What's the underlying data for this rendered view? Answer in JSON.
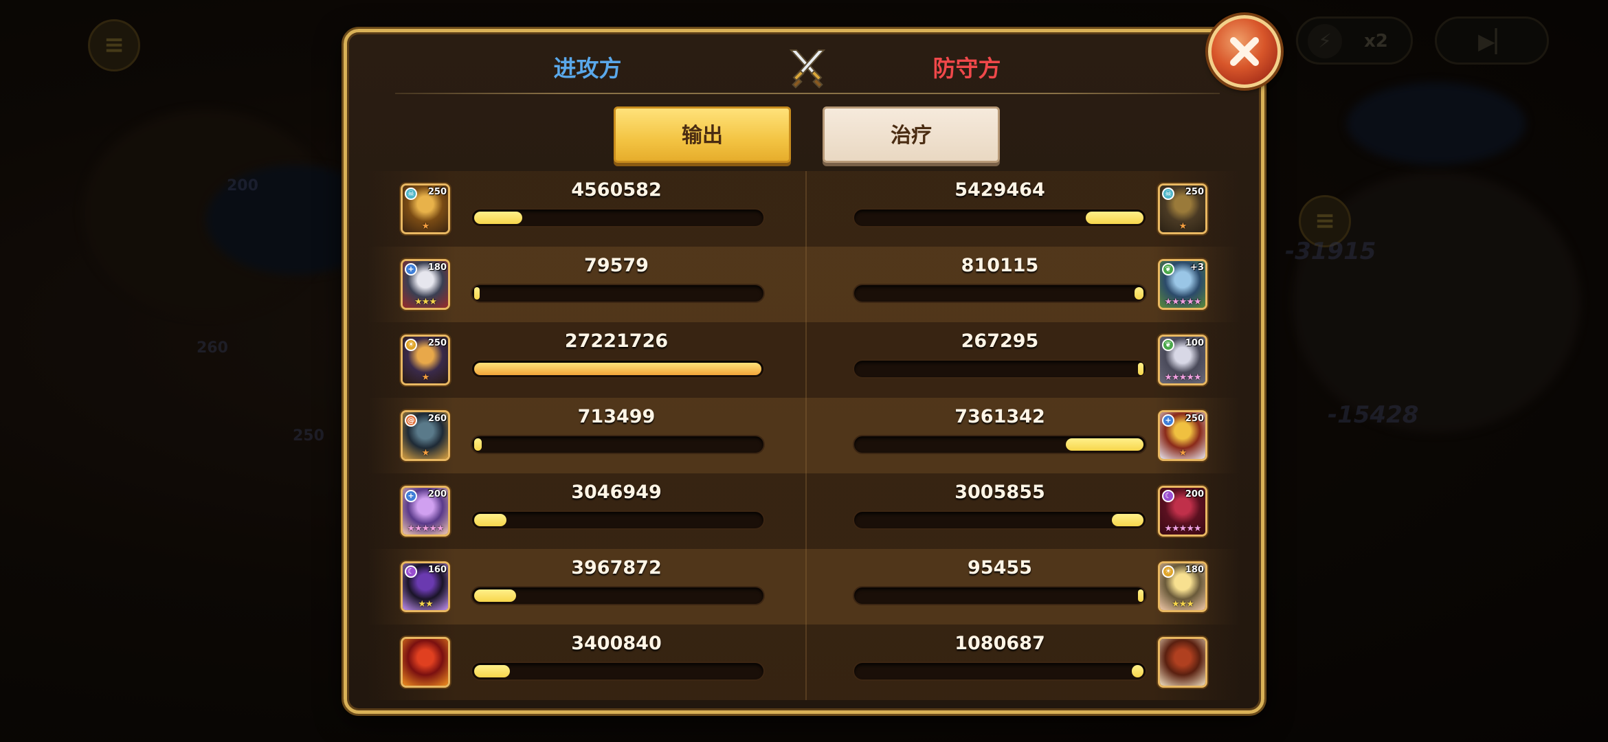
{
  "header": {
    "attacker_label": "进攻方",
    "defender_label": "防守方"
  },
  "tabs": {
    "output_label": "输出",
    "heal_label": "治疗",
    "active": "output"
  },
  "background": {
    "speed_label": "x2",
    "ghost_numbers": [
      "-31915",
      "-15428",
      "200",
      "260",
      "250"
    ]
  },
  "rows": [
    {
      "attacker": {
        "value": "4560582",
        "ratio": 0.168,
        "level": "250",
        "element": "skull",
        "stars": 1,
        "art": "gold-armored-hero"
      },
      "defender": {
        "value": "5429464",
        "ratio": 0.2,
        "level": "250",
        "element": "skull",
        "stars": 1,
        "art": "brown-beast"
      }
    },
    {
      "attacker": {
        "value": "79579",
        "ratio": 0.003,
        "level": "180",
        "element": "plus",
        "stars": 3,
        "art": "white-haired-hero"
      },
      "defender": {
        "value": "810115",
        "ratio": 0.03,
        "level": "+3",
        "element": "leaf",
        "stars": 5,
        "art": "blue-elf"
      }
    },
    {
      "attacker": {
        "value": "27221726",
        "ratio": 1.0,
        "level": "250",
        "element": "sun",
        "stars": 1,
        "art": "witch-hat-hero"
      },
      "defender": {
        "value": "267295",
        "ratio": 0.01,
        "level": "100",
        "element": "leaf",
        "stars": 5,
        "art": "pale-ghost"
      }
    },
    {
      "attacker": {
        "value": "713499",
        "ratio": 0.026,
        "level": "260",
        "element": "swirl",
        "stars": 1,
        "art": "dark-knight"
      },
      "defender": {
        "value": "7361342",
        "ratio": 0.27,
        "level": "250",
        "element": "plus",
        "stars": 1,
        "art": "golden-lion"
      }
    },
    {
      "attacker": {
        "value": "3046949",
        "ratio": 0.112,
        "level": "200",
        "element": "plus",
        "stars": 5,
        "art": "purple-haired-girl"
      },
      "defender": {
        "value": "3005855",
        "ratio": 0.11,
        "level": "200",
        "element": "moon",
        "stars": 5,
        "art": "crimson-demon"
      }
    },
    {
      "attacker": {
        "value": "3967872",
        "ratio": 0.146,
        "level": "160",
        "element": "moon",
        "stars": 2,
        "art": "shadow-mage"
      },
      "defender": {
        "value": "95455",
        "ratio": 0.004,
        "level": "180",
        "element": "sun",
        "stars": 3,
        "art": "blonde-priestess"
      }
    },
    {
      "attacker": {
        "value": "3400840",
        "ratio": 0.125,
        "level": "",
        "element": "",
        "stars": 0,
        "art": "red-dragon"
      },
      "defender": {
        "value": "1080687",
        "ratio": 0.04,
        "level": "",
        "element": "",
        "stars": 0,
        "art": "tusked-boar"
      }
    }
  ],
  "colors": {
    "attacker": "#5aa8ea",
    "defender": "#f0484a",
    "bar_fill": "#f7d64c",
    "panel_border": "#d9b157"
  }
}
